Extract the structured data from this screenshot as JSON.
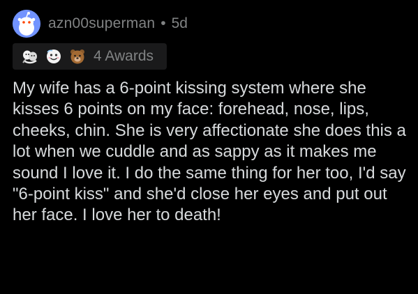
{
  "comment": {
    "username": "azn00superman",
    "separator": "•",
    "age": "5d",
    "awards": {
      "icons": [
        "hugz-award-icon",
        "wholesome-award-icon",
        "bear-award-icon"
      ],
      "label": "4 Awards"
    },
    "body": "My wife has a 6-point kissing system where she kisses 6 points on my face: forehead, nose, lips, cheeks, chin. She is very affectionate she does this a lot when we cuddle and as sappy as it makes me sound I love it. I do the same thing for her too, I'd say \"6-point kiss\" and she'd close her eyes and put out her face. I love her to death!"
  },
  "colors": {
    "background": "#000000",
    "meta_text": "#818384",
    "body_text": "#d7dadc",
    "awards_bg": "#1a1a1b",
    "avatar_bg": "#7193ff"
  }
}
